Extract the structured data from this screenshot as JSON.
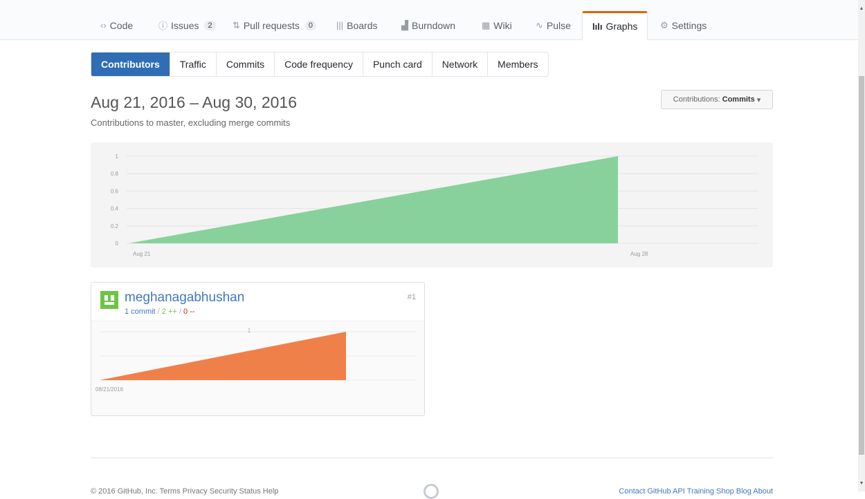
{
  "repo_nav": [
    {
      "icon": "‹›",
      "label": "Code",
      "count": null
    },
    {
      "icon": "ⓘ",
      "label": "Issues",
      "count": "2"
    },
    {
      "icon": "⇅",
      "label": "Pull requests",
      "count": "0"
    },
    {
      "icon": "|||",
      "label": "Boards",
      "count": null
    },
    {
      "icon": "▟",
      "label": "Burndown",
      "count": null
    },
    {
      "icon": "▦",
      "label": "Wiki",
      "count": null
    },
    {
      "icon": "∿",
      "label": "Pulse",
      "count": null
    },
    {
      "icon": "lılı",
      "label": "Graphs",
      "count": null
    },
    {
      "icon": "⚙",
      "label": "Settings",
      "count": null
    }
  ],
  "subnav": [
    "Contributors",
    "Traffic",
    "Commits",
    "Code frequency",
    "Punch card",
    "Network",
    "Members"
  ],
  "range_title": "Aug 21, 2016 – Aug 30, 2016",
  "range_subtitle": "Contributions to master, excluding merge commits",
  "contributions_button": {
    "prefix": "Contributions:",
    "value": "Commits"
  },
  "chart_data": [
    {
      "type": "area",
      "title": "",
      "x": [
        "Aug 21",
        "Aug 28"
      ],
      "y": [
        0,
        1
      ],
      "yticks": [
        0,
        0.2,
        0.4,
        0.6,
        0.8,
        1
      ],
      "xticks": [
        "Aug 21",
        "Aug 28"
      ],
      "xlabel": "",
      "ylabel": "",
      "ylim": [
        0,
        1
      ],
      "grid": true,
      "color": "#88d19c"
    },
    {
      "type": "area",
      "title": "",
      "x": [
        "08/21/2016",
        "Aug 28"
      ],
      "y": [
        0,
        1
      ],
      "yticks": [
        1
      ],
      "xticks": [
        "08/21/2016"
      ],
      "ylim": [
        0,
        1
      ],
      "grid": true,
      "color": "#f0804a"
    }
  ],
  "contributor": {
    "name": "meghanagabhushan",
    "commits": "1 commit",
    "slash": "/",
    "additions": "2 ++",
    "deletions": "0 --",
    "rank": "#1"
  },
  "footer": {
    "left": "© 2016 GitHub, Inc.   Terms   Privacy   Security   Status   Help",
    "right": "Contact GitHub   API   Training   Shop   Blog   About"
  }
}
